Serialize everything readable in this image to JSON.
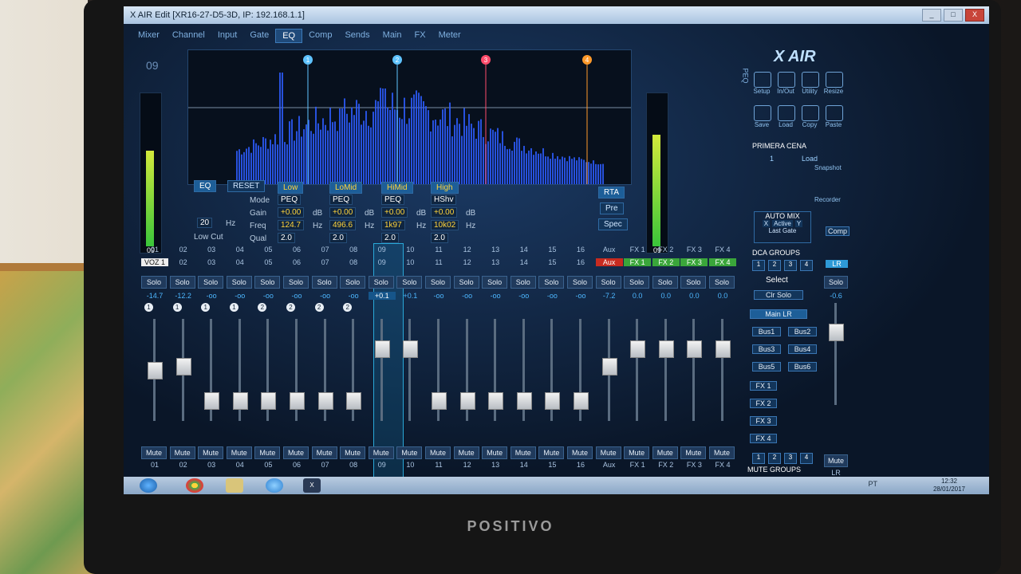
{
  "window": {
    "title": "X AIR Edit [XR16-27-D5-3D, IP: 192.168.1.1]",
    "controls": [
      "_",
      "□",
      "X"
    ]
  },
  "tabs": [
    "Mixer",
    "Channel",
    "Input",
    "Gate",
    "EQ",
    "Comp",
    "Sends",
    "Main",
    "FX",
    "Meter"
  ],
  "active_tab": "EQ",
  "channel_number": "09",
  "logo": "X AIR",
  "eq": {
    "buttons": {
      "eq": "EQ",
      "reset": "RESET",
      "rta": "RTA",
      "pre": "Pre",
      "spec": "Spec"
    },
    "peq_label": "PEQ",
    "row_labels": {
      "mode": "Mode",
      "gain": "Gain",
      "freq": "Freq",
      "qual": "Qual",
      "low_cut": "Low Cut",
      "hz": "Hz",
      "db": "dB"
    },
    "low_cut_value": "20",
    "bands": [
      {
        "name": "Low",
        "mode": "PEQ",
        "gain": "+0.00",
        "freq": "124.7",
        "qual": "2.0"
      },
      {
        "name": "LoMid",
        "mode": "PEQ",
        "gain": "+0.00",
        "freq": "496.6",
        "qual": "2.0"
      },
      {
        "name": "HiMid",
        "mode": "PEQ",
        "gain": "+0.00",
        "freq": "1k97",
        "qual": "2.0"
      },
      {
        "name": "High",
        "mode": "HShv",
        "gain": "+0.00",
        "freq": "10k02",
        "qual": "2.0"
      }
    ],
    "markers": [
      "1",
      "2",
      "3",
      "4"
    ],
    "left_meter_label": "09",
    "right_meter_label": "09"
  },
  "strips": {
    "top_numbers": [
      "01",
      "02",
      "03",
      "04",
      "05",
      "06",
      "07",
      "08",
      "09",
      "10",
      "11",
      "12",
      "13",
      "14",
      "15",
      "16",
      "Aux",
      "FX 1",
      "FX 2",
      "FX 3",
      "FX 4"
    ],
    "names": [
      "VOZ 1",
      "02",
      "03",
      "04",
      "05",
      "06",
      "07",
      "08",
      "09",
      "10",
      "11",
      "12",
      "13",
      "14",
      "15",
      "16",
      "Aux",
      "FX 1",
      "FX 2",
      "FX 3",
      "FX 4"
    ],
    "solo_label": "Solo",
    "gains": [
      "-14.7",
      "-12.2",
      "-oo",
      "-oo",
      "-oo",
      "-oo",
      "-oo",
      "-oo",
      "+0.1",
      "+0.1",
      "-oo",
      "-oo",
      "-oo",
      "-oo",
      "-oo",
      "-oo",
      "-7.2",
      "0.0",
      "0.0",
      "0.0",
      "0.0"
    ],
    "dca": [
      "1",
      "1",
      "1",
      "1",
      "2",
      "2",
      "2",
      "2",
      "",
      "",
      "",
      "",
      "",
      "",
      "",
      "",
      "",
      "",
      "",
      "",
      ""
    ],
    "fader_levels": [
      0.5,
      0.55,
      0.15,
      0.15,
      0.15,
      0.15,
      0.15,
      0.15,
      0.75,
      0.75,
      0.15,
      0.15,
      0.15,
      0.15,
      0.15,
      0.15,
      0.55,
      0.75,
      0.75,
      0.75,
      0.75
    ],
    "mute_label": "Mute",
    "bottom_labels": [
      "01",
      "02",
      "03",
      "04",
      "05",
      "06",
      "07",
      "08",
      "09",
      "10",
      "11",
      "12",
      "13",
      "14",
      "15",
      "16",
      "Aux",
      "FX 1",
      "FX 2",
      "FX 3",
      "FX 4"
    ],
    "selected": "09"
  },
  "right_panel": {
    "icons": [
      {
        "label": "Setup"
      },
      {
        "label": "In/Out"
      },
      {
        "label": "Utility"
      },
      {
        "label": "Resize"
      },
      {
        "label": "Save"
      },
      {
        "label": "Load"
      },
      {
        "label": "Copy"
      },
      {
        "label": "Paste"
      }
    ],
    "scene_name": "PRIMERA CENA",
    "scene_nav": {
      "num": "1",
      "load": "Load"
    },
    "snapshot": "Snapshot",
    "recorder": "Recorder",
    "automix": {
      "title": "AUTO MIX",
      "x": "X",
      "active": "Active",
      "y": "Y",
      "last_gate": "Last Gate"
    },
    "dca_groups": {
      "title": "DCA GROUPS",
      "nums": [
        "1",
        "2",
        "3",
        "4"
      ]
    },
    "select": "Select",
    "clr_solo": "Clr Solo",
    "main_lr": "Main LR",
    "buses": [
      "Bus1",
      "Bus2",
      "Bus3",
      "Bus4",
      "Bus5",
      "Bus6"
    ],
    "fx": [
      "FX 1",
      "FX 2",
      "FX 3",
      "FX 4"
    ],
    "mute_groups": {
      "title": "MUTE GROUPS",
      "nums": [
        "1",
        "2",
        "3",
        "4"
      ]
    },
    "lr": {
      "comp": "Comp",
      "label": "LR",
      "solo": "Solo",
      "gain": "-0.6",
      "mute": "Mute",
      "bottom": "LR"
    }
  },
  "taskbar": {
    "clock": "12:32",
    "date": "28/01/2017",
    "lang": "PT"
  },
  "brand": "POSITIVO"
}
